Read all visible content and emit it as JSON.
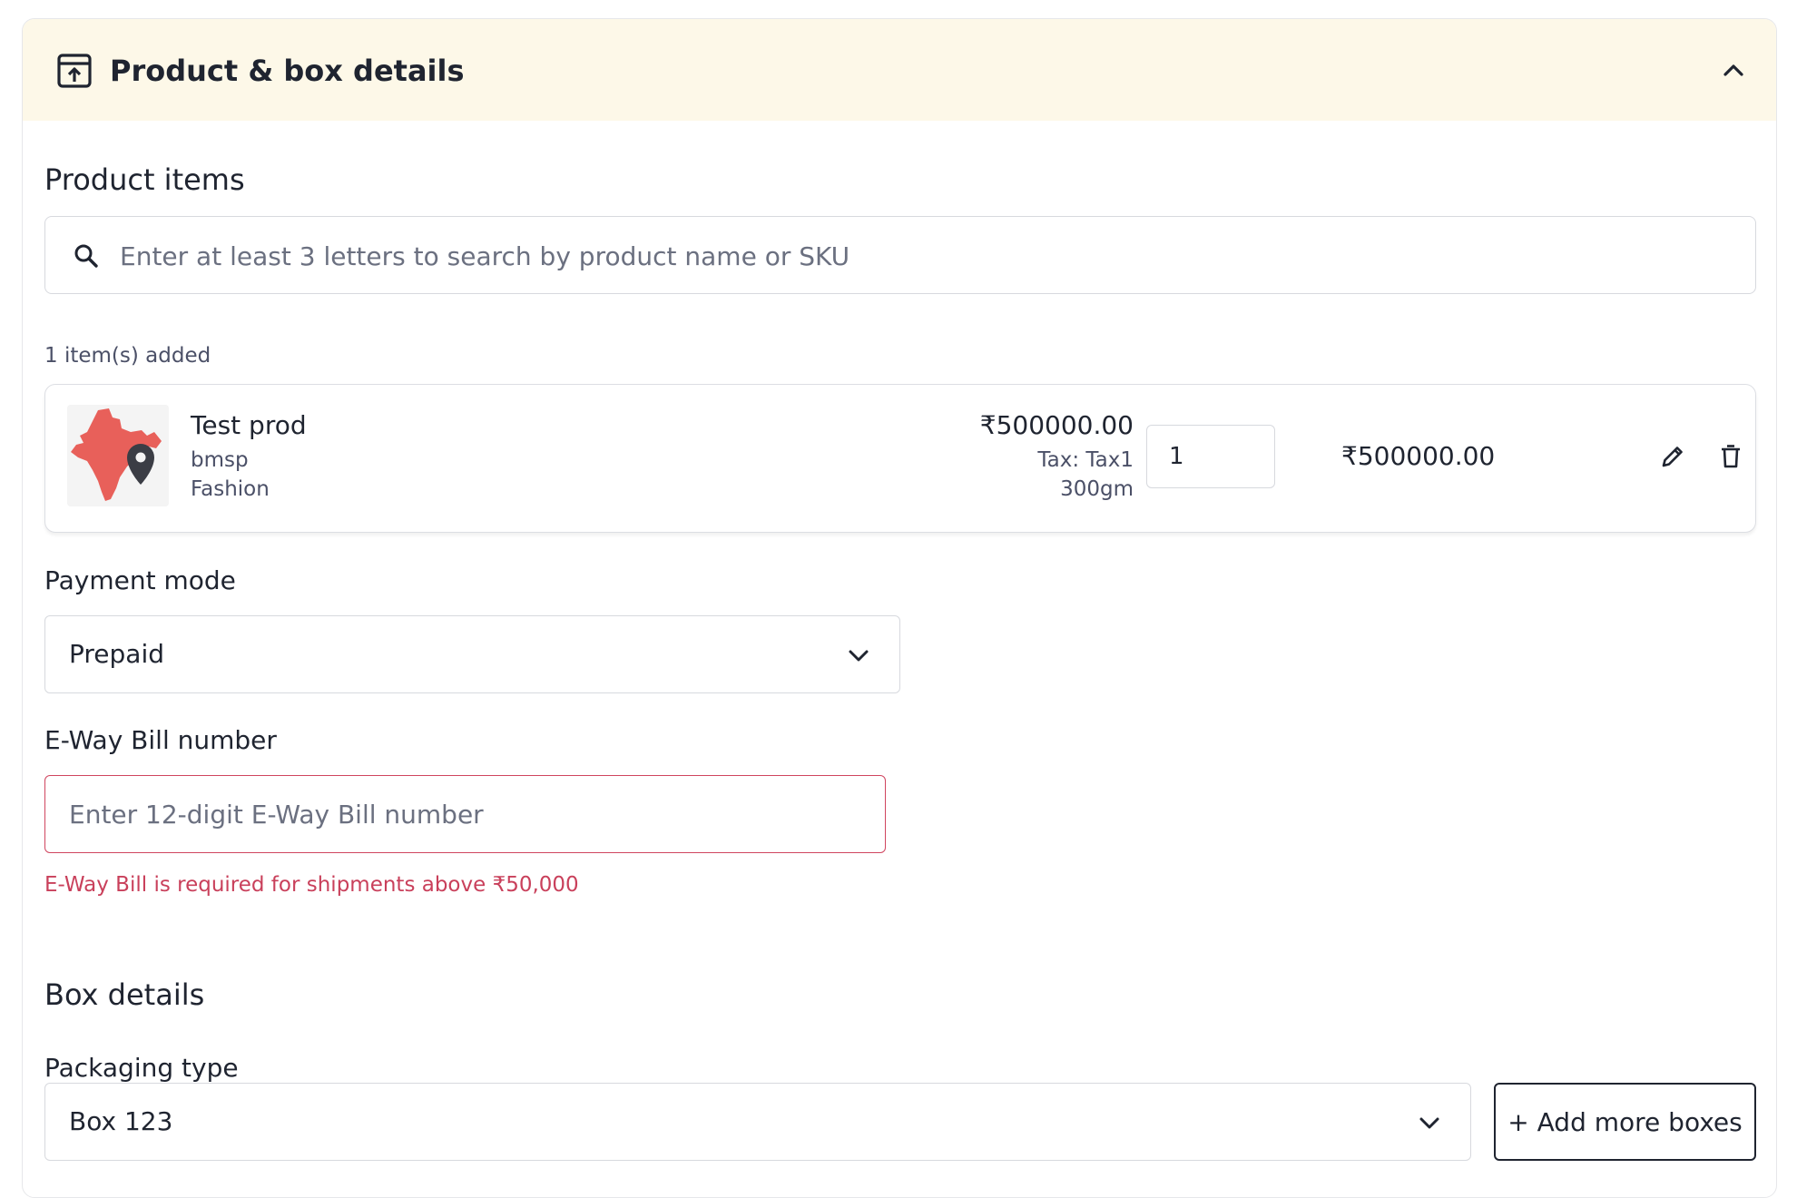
{
  "header": {
    "title": "Product & box details",
    "icon": "box-upload-icon",
    "collapse_icon": "chevron-up-icon"
  },
  "product_items": {
    "title": "Product items",
    "search": {
      "placeholder": "Enter at least 3 letters to search by product name or SKU",
      "value": ""
    },
    "count_text": "1 item(s) added",
    "items": [
      {
        "name": "Test prod",
        "sku": "bmsp",
        "category": "Fashion",
        "unit_price": "₹500000.00",
        "tax": "Tax: Tax1",
        "weight": "300gm",
        "quantity": "1",
        "total": "₹500000.00",
        "image": "india-map-pin-image"
      }
    ]
  },
  "payment": {
    "label": "Payment mode",
    "selected": "Prepaid"
  },
  "eway": {
    "label": "E-Way Bill number",
    "placeholder": "Enter 12-digit E-Way Bill number",
    "value": "",
    "error": "E-Way Bill is required for shipments above ₹50,000"
  },
  "box_details": {
    "title": "Box details",
    "packaging_label": "Packaging type",
    "packaging_selected": "Box 123",
    "add_more_label": "+ Add more boxes"
  },
  "colors": {
    "header_bg": "#fdf8e8",
    "error": "#c9405b",
    "border": "#d7d9de",
    "text": "#1f2430",
    "map_red": "#e8605a"
  }
}
